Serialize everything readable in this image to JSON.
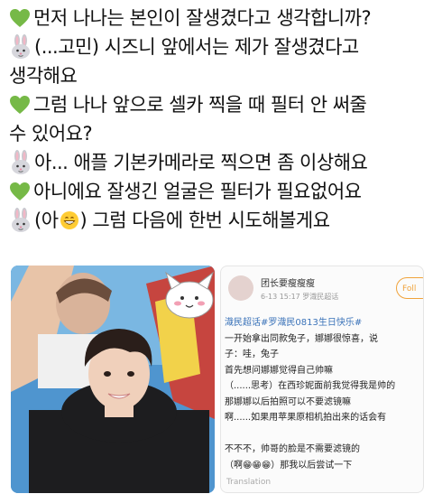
{
  "dialog": {
    "line1": "먼저 나나는 본인이 잘생겼다고 생각합니까?",
    "line2": "(...고민) 시즈니 앞에서는 제가 잘생겼다고",
    "line3": "생각해요",
    "line4": "그럼 나나 앞으로 셀카 찍을 때 필터 안 써줄",
    "line5": "수 있어요?",
    "line6": "아... 애플 기본카메라로 찍으면 좀 이상해요",
    "line7": "아니에요 잘생긴 얼굴은 필터가 필요없어요",
    "line8_a": "(아",
    "line8_b": ") 그럼 다음에 한번 시도해볼게요"
  },
  "post": {
    "username": "团长要瘦瘦瘦",
    "meta": "6-13 15:17   罗渽民超话",
    "follow_label": "Foll",
    "lines": [
      "渽民超话#罗渽民0813生日快乐#",
      "一开始拿出同款兔子，娜娜很惊喜，说",
      "子：哇，兔子",
      "首先想问娜娜觉得自己帅嘛",
      "（......思考）在西珍妮面前我觉得我是帅的",
      "那娜娜以后拍照可以不要滤镜嘛",
      "啊......如果用苹果原相机拍出来的话会有",
      "",
      "不不不，帅哥的脸是不需要滤镜的",
      "（啊😁😁😁）那我以后尝试一下"
    ],
    "translation": "Translation"
  },
  "icons": {
    "heart": "green-heart-icon",
    "rabbit": "rabbit-face-icon",
    "grin": "grinning-face-icon"
  },
  "colors": {
    "heart": "#76b947",
    "topic_link": "#3b73b9",
    "follow": "#f0a33b"
  }
}
